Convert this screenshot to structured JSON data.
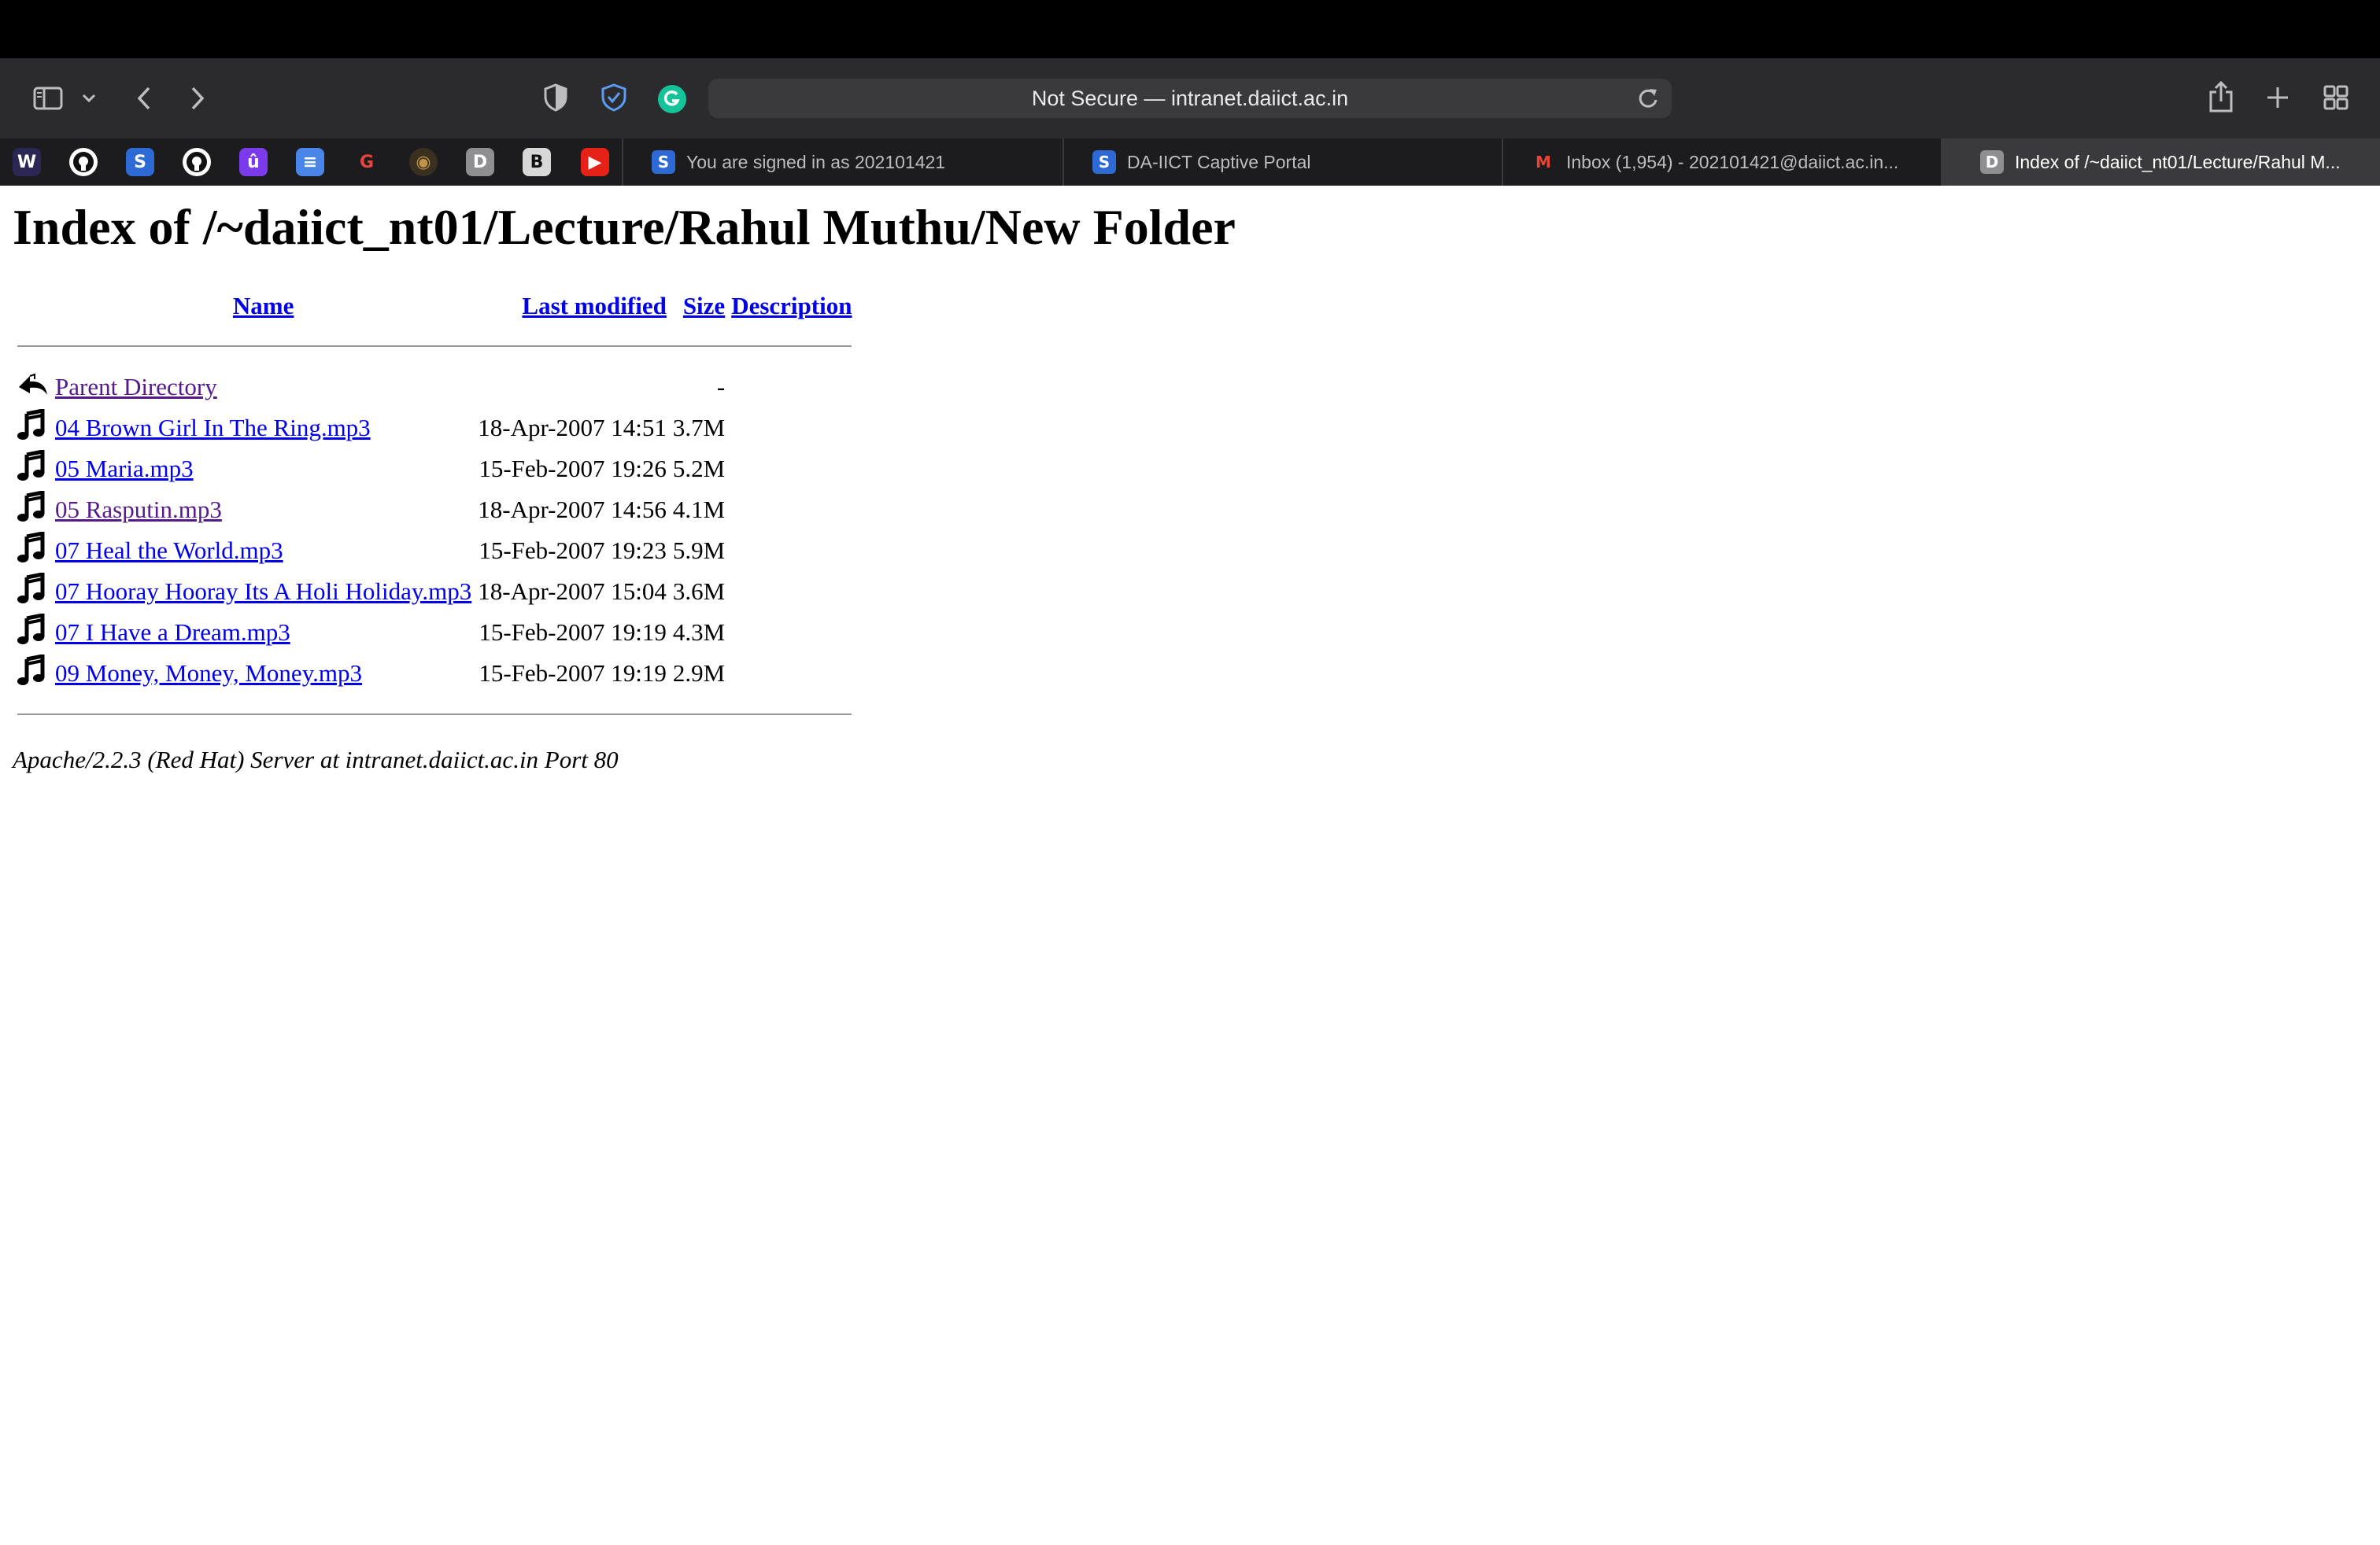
{
  "browser": {
    "url_display": "Not Secure — intranet.daiict.ac.in",
    "toolbar_icons": [
      "sidebar-icon",
      "chevron-down-icon",
      "back-icon",
      "forward-icon",
      "shield-icon",
      "bitwarden-icon",
      "grammarly-icon",
      "reload-icon",
      "share-icon",
      "new-tab-icon",
      "tab-overview-icon"
    ],
    "favorites": [
      {
        "name": "w-bookmark",
        "glyph": "W",
        "color": "#2a2755"
      },
      {
        "name": "github-bookmark",
        "glyph": "",
        "color": "#ffffff"
      },
      {
        "name": "s-bookmark",
        "glyph": "S",
        "color": "#2d6ad6"
      },
      {
        "name": "github-bookmark-2",
        "glyph": "",
        "color": "#ffffff"
      },
      {
        "name": "u-bookmark",
        "glyph": "û",
        "color": "#7c3aed"
      },
      {
        "name": "docs-bookmark",
        "glyph": "≡",
        "color": "#4a86e8"
      },
      {
        "name": "g-bookmark",
        "glyph": "G",
        "color": "#1c1c1e"
      },
      {
        "name": "circle-bookmark",
        "glyph": "◉",
        "color": "#3a3020"
      },
      {
        "name": "d-bookmark",
        "glyph": "D",
        "color": "#8e8e93"
      },
      {
        "name": "b-bookmark",
        "glyph": "B",
        "color": "#d8d8d8"
      },
      {
        "name": "youtube-bookmark",
        "glyph": "▶",
        "color": "#e62117"
      }
    ],
    "tabs": [
      {
        "label": "You are signed in as 202101421",
        "icon": "S",
        "icon_color": "#2d6ad6"
      },
      {
        "label": "DA-IICT Captive Portal",
        "icon": "S",
        "icon_color": "#2d6ad6"
      },
      {
        "label": "Inbox (1,954) - 202101421@daiict.ac.in...",
        "icon": "M",
        "icon_color": "#1c1c1e"
      },
      {
        "label": "Index of /~daiict_nt01/Lecture/Rahul M...",
        "icon": "D",
        "icon_color": "#8e8e93"
      }
    ]
  },
  "page": {
    "title": "Index of /~daiict_nt01/Lecture/Rahul Muthu/New Folder",
    "columns": {
      "name": "Name",
      "last_modified": "Last modified",
      "size": "Size",
      "description": "Description"
    },
    "parent": {
      "label": "Parent Directory",
      "size": "-"
    },
    "files": [
      {
        "name": "04 Brown Girl In The Ring.mp3",
        "modified": "18-Apr-2007 14:51",
        "size": "3.7M",
        "visited": false
      },
      {
        "name": "05 Maria.mp3",
        "modified": "15-Feb-2007 19:26",
        "size": "5.2M",
        "visited": false
      },
      {
        "name": "05 Rasputin.mp3",
        "modified": "18-Apr-2007 14:56",
        "size": "4.1M",
        "visited": true
      },
      {
        "name": "07 Heal the World.mp3",
        "modified": "15-Feb-2007 19:23",
        "size": "5.9M",
        "visited": false
      },
      {
        "name": "07 Hooray Hooray Its A Holi Holiday.mp3",
        "modified": "18-Apr-2007 15:04",
        "size": "3.6M",
        "visited": false
      },
      {
        "name": "07 I Have a Dream.mp3",
        "modified": "15-Feb-2007 19:19",
        "size": "4.3M",
        "visited": false
      },
      {
        "name": "09 Money, Money, Money.mp3",
        "modified": "15-Feb-2007 19:19",
        "size": "2.9M",
        "visited": false
      }
    ],
    "server_signature": "Apache/2.2.3 (Red Hat) Server at intranet.daiict.ac.in Port 80"
  },
  "colors": {
    "link": "#0000ee",
    "visited_link": "#551a8b",
    "chrome_dark": "#2b2b2d",
    "tab_active": "#3a3a3c"
  }
}
